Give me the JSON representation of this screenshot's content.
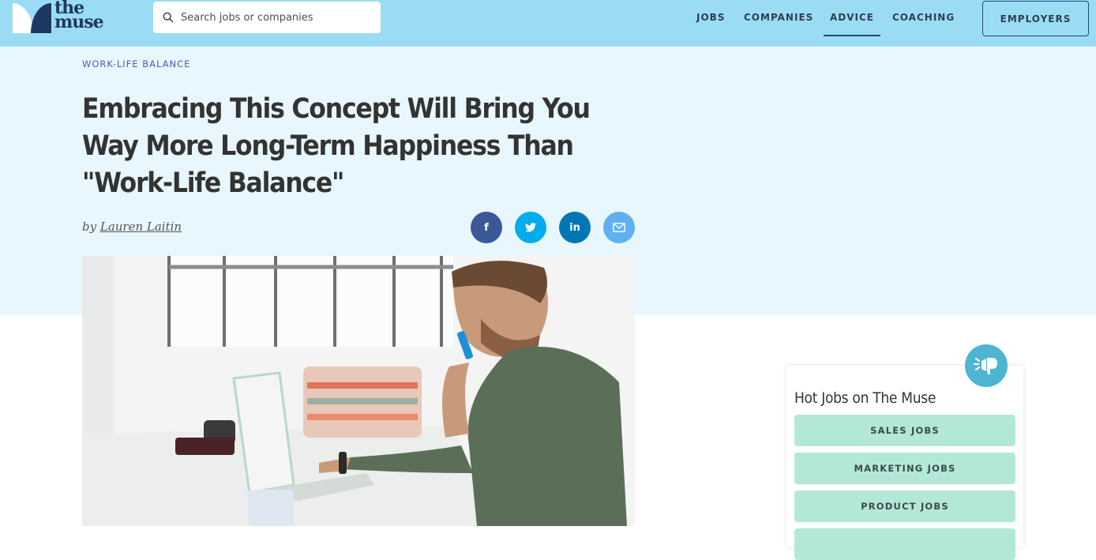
{
  "header": {
    "logo_text_line1": "the",
    "logo_text_line2": "muse",
    "search": {
      "placeholder": "Search jobs or companies",
      "value": ""
    },
    "nav": [
      {
        "label": "JOBS",
        "active": false
      },
      {
        "label": "COMPANIES",
        "active": false
      },
      {
        "label": "ADVICE",
        "active": true
      },
      {
        "label": "COACHING",
        "active": false
      }
    ],
    "employers_label": "EMPLOYERS"
  },
  "article": {
    "category": "WORK-LIFE BALANCE",
    "title": "Embracing This Concept Will Bring You Way More Long-Term Happiness Than \"Work-Life Balance\"",
    "byline_prefix": "by",
    "author": "Lauren Laitin",
    "share": [
      {
        "network": "facebook",
        "glyph": "f",
        "color": "#3b5998"
      },
      {
        "network": "twitter",
        "glyph": "twitter-bird",
        "color": "#00aced"
      },
      {
        "network": "linkedin",
        "glyph": "in",
        "color": "#0077b5"
      },
      {
        "network": "email",
        "glyph": "envelope",
        "color": "#5fb0f0"
      }
    ],
    "hero_image_alt": "Man smiling on phone while typing on laptop at a white desk"
  },
  "sidebar": {
    "hot_jobs_title": "Hot Jobs on The Muse",
    "jobs": [
      "SALES JOBS",
      "MARKETING JOBS",
      "PRODUCT JOBS",
      ""
    ]
  },
  "colors": {
    "topbar": "#9bdcf5",
    "hero_bg": "#e8f7fe",
    "navy": "#1e3763",
    "kicker": "#4a59b8",
    "job_button": "#b3e8d8",
    "megaphone_badge": "#4db5d1"
  }
}
